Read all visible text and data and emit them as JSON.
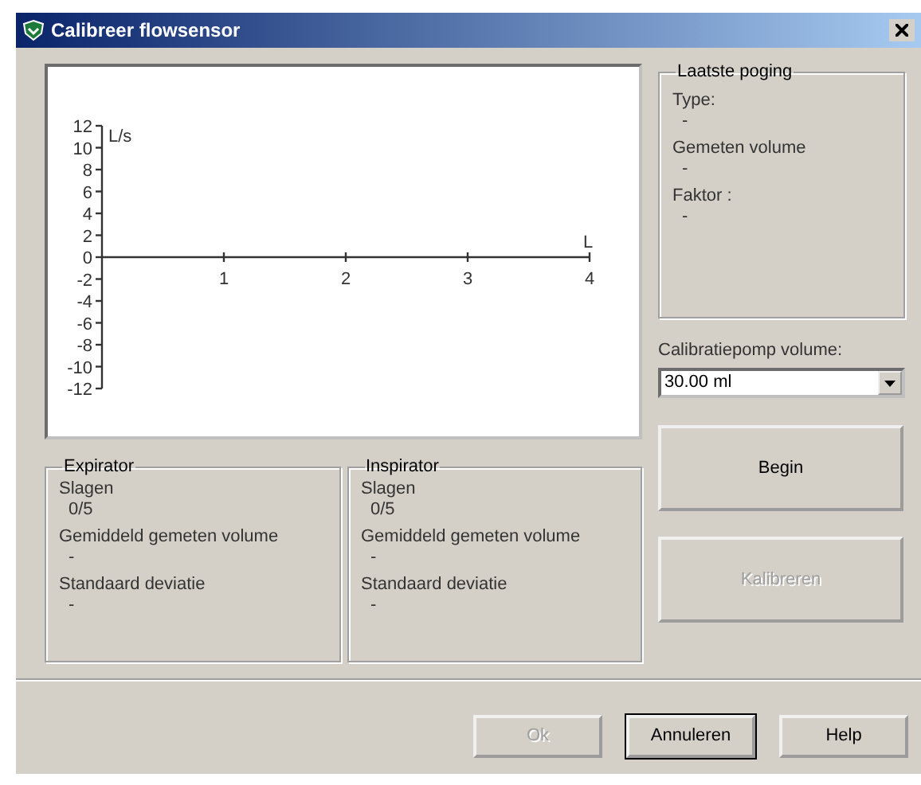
{
  "window": {
    "title": "Calibreer flowsensor"
  },
  "chart": {
    "chart_data": {
      "type": "line",
      "xlabel": "L",
      "ylabel": "L/s",
      "xlim": [
        0,
        4
      ],
      "ylim": [
        -12,
        12
      ],
      "xticks": [
        1,
        2,
        3,
        4
      ],
      "yticks": [
        12,
        10,
        8,
        6,
        4,
        2,
        0,
        -2,
        -4,
        -6,
        -8,
        -10,
        -12
      ]
    }
  },
  "last_attempt": {
    "title": "Laatste poging",
    "fields": [
      {
        "label": "Type:",
        "value": "-"
      },
      {
        "label": "Gemeten volume",
        "value": "-"
      },
      {
        "label": "Faktor :",
        "value": "-"
      }
    ]
  },
  "pump_volume": {
    "label": "Calibratiepomp volume:",
    "value": "30.00 ml"
  },
  "groups": [
    {
      "title": "Expirator",
      "fields": [
        {
          "label": "Slagen",
          "value": "0/5"
        },
        {
          "label": "Gemiddeld gemeten volume",
          "value": "-"
        },
        {
          "label": "Standaard deviatie",
          "value": "-"
        }
      ]
    },
    {
      "title": "Inspirator",
      "fields": [
        {
          "label": "Slagen",
          "value": "0/5"
        },
        {
          "label": "Gemiddeld gemeten volume",
          "value": "-"
        },
        {
          "label": "Standaard deviatie",
          "value": "-"
        }
      ]
    }
  ],
  "side_buttons": [
    {
      "label": "Begin",
      "disabled": false
    },
    {
      "label": "Kalibreren",
      "disabled": true
    }
  ],
  "buttons": [
    {
      "label": "Ok",
      "disabled": true,
      "focused": false
    },
    {
      "label": "Annuleren",
      "disabled": false,
      "focused": true
    },
    {
      "label": "Help",
      "disabled": false,
      "focused": false
    }
  ]
}
